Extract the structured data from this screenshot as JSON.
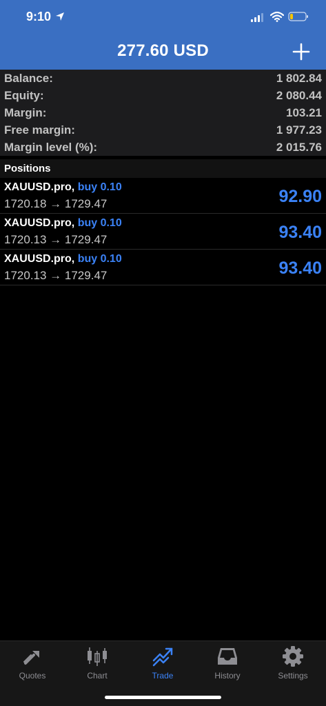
{
  "status_bar": {
    "time": "9:10"
  },
  "header": {
    "title": "277.60 USD",
    "add_icon": "plus-icon"
  },
  "summary": [
    {
      "label": "Balance:",
      "value": "1 802.84"
    },
    {
      "label": "Equity:",
      "value": "2 080.44"
    },
    {
      "label": "Margin:",
      "value": "103.21"
    },
    {
      "label": "Free margin:",
      "value": "1 977.23"
    },
    {
      "label": "Margin level (%):",
      "value": "2 015.76"
    }
  ],
  "positions": {
    "title": "Positions",
    "items": [
      {
        "symbol": "XAUUSD.pro,",
        "side": "buy 0.10",
        "prices": "1720.18 → 1729.47",
        "profit": "92.90"
      },
      {
        "symbol": "XAUUSD.pro,",
        "side": "buy 0.10",
        "prices": "1720.13 → 1729.47",
        "profit": "93.40"
      },
      {
        "symbol": "XAUUSD.pro,",
        "side": "buy 0.10",
        "prices": "1720.13 → 1729.47",
        "profit": "93.40"
      }
    ]
  },
  "tabs": [
    {
      "label": "Quotes",
      "icon": "quotes-arrows-icon"
    },
    {
      "label": "Chart",
      "icon": "candlestick-chart-icon"
    },
    {
      "label": "Trade",
      "icon": "trade-trend-icon",
      "active": true
    },
    {
      "label": "History",
      "icon": "inbox-tray-icon"
    },
    {
      "label": "Settings",
      "icon": "gear-icon"
    }
  ],
  "colors": {
    "header_bg": "#3a6fc2",
    "accent": "#3b82f6",
    "background": "#000000"
  }
}
